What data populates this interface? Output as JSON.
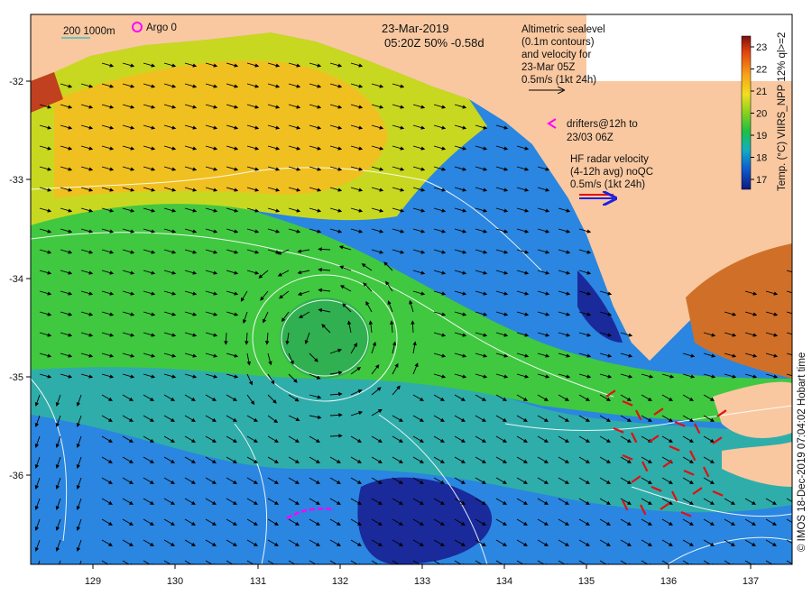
{
  "title": {
    "date": "23-Mar-2019",
    "info": "05:20Z  50% -0.58d"
  },
  "scale_bar_label": "200  1000m",
  "argo_legend": "Argo 0",
  "altimetry_legend": [
    "Altimetric sealevel",
    "(0.1m contours)",
    "and velocity for",
    "23-Mar 05Z",
    "0.5m/s (1kt 24h)"
  ],
  "drifters_legend": [
    "drifters@12h to",
    "23/03 06Z"
  ],
  "hf_radar_legend": [
    "HF radar velocity",
    "(4-12h avg) noQC",
    "0.5m/s (1kt 24h)"
  ],
  "colorbar": {
    "label": "Temp. (°C)  VIIRS_NPP 12% ql>=2",
    "ticks": [
      "23",
      "22",
      "21",
      "20",
      "19",
      "18",
      "17"
    ]
  },
  "credit": "© IMOS 18-Dec-2019 07:04:02 Hobart time",
  "axes": {
    "x_ticks": [
      "129",
      "130",
      "131",
      "132",
      "133",
      "134",
      "135",
      "136",
      "137"
    ],
    "y_ticks": [
      "-32",
      "-33",
      "-34",
      "-35",
      "-36"
    ]
  },
  "colors": {
    "land": "#f9c8a0",
    "ocean_warm": "#f0d020",
    "ocean_mid": "#34c832",
    "ocean_cool": "#1e8ce6",
    "ocean_cold": "#1a2a9a",
    "velocity_arrow": "#000000",
    "hf_radar_arrow": "#e01010",
    "drifter_track": "#ff00ff",
    "contour": "#ffffff"
  }
}
